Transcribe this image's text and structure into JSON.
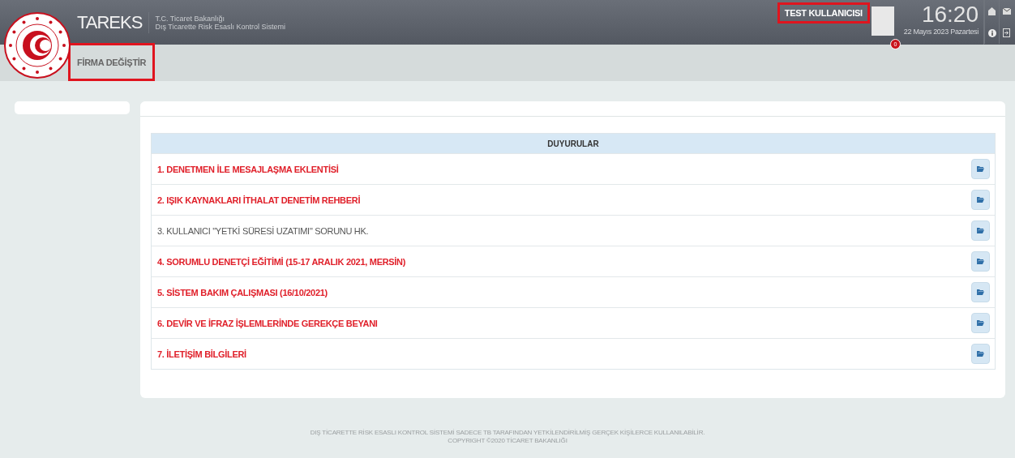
{
  "header": {
    "brand": "TAREKS",
    "ministry": "T.C. Ticaret Bakanlığı",
    "system": "Dış Ticarette Risk Esaslı Kontrol Sistemi",
    "user": {
      "name": "TEST KULLANICISI",
      "highlighted": true
    },
    "badge": "0",
    "time": "16:20",
    "date": "22 Mayıs 2023 Pazartesi"
  },
  "subbar": {
    "button": {
      "label": "FİRMA DEĞİŞTİR",
      "highlighted": true
    }
  },
  "announcements": {
    "title": "DUYURULAR",
    "rows": [
      {
        "label": "1. DENETMEN İLE MESAJLAŞMA EKLENTİSİ",
        "important": true
      },
      {
        "label": "2. IŞIK KAYNAKLARI İTHALAT DENETİM REHBERİ",
        "important": true
      },
      {
        "label": "3. KULLANICI \"YETKİ SÜRESİ UZATIMI\" SORUNU HK.",
        "important": false
      },
      {
        "label": "4. SORUMLU DENETÇİ EĞİTİMİ (15-17 ARALIK 2021, MERSİN)",
        "important": true
      },
      {
        "label": "5. SİSTEM BAKIM ÇALIŞMASI (16/10/2021)",
        "important": true
      },
      {
        "label": "6. DEVİR VE İFRAZ İŞLEMLERİNDE GEREKÇE BEYANI",
        "important": true
      },
      {
        "label": "7. İLETİŞİM BİLGİLERİ",
        "important": true
      }
    ]
  },
  "footer": {
    "notice": "DIŞ TİCARETTE RİSK ESASLI KONTROL SİSTEMİ SADECE TB TARAFINDAN YETKİLENDİRİLMİŞ GERÇEK KİŞİLERCE KULLANILABİLİR.",
    "copyright": "COPYRIGHT ©2020 TİCARET BAKANLIĞI"
  }
}
